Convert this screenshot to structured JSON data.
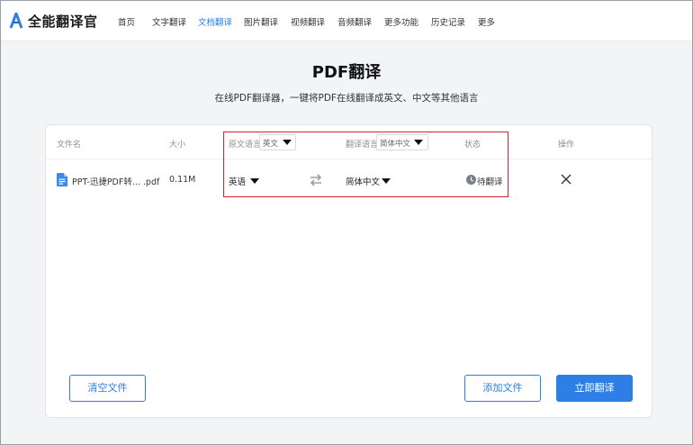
{
  "app": {
    "logo_text": "全能翻译官",
    "brand_color": "#2d7fe6",
    "highlight_color": "#d9232c"
  },
  "nav": {
    "items": [
      {
        "label": "首页",
        "active": false
      },
      {
        "label": "文字翻译",
        "active": false
      },
      {
        "label": "文档翻译",
        "active": true
      },
      {
        "label": "图片翻译",
        "active": false
      },
      {
        "label": "视频翻译",
        "active": false
      },
      {
        "label": "音频翻译",
        "active": false
      },
      {
        "label": "更多功能",
        "active": false
      },
      {
        "label": "历史记录",
        "active": false
      },
      {
        "label": "更多",
        "active": false
      }
    ]
  },
  "page": {
    "title": "PDF翻译",
    "subtitle": "在线PDF翻译器，一键将PDF在线翻译成英文、中文等其他语言"
  },
  "table": {
    "headers": {
      "file_name": "文件名",
      "size": "大小",
      "source_lang": "原文语言",
      "target_lang": "翻译语言",
      "status": "状态",
      "action": "操作"
    },
    "header_source_select": "英文",
    "header_target_select": "简体中文",
    "rows": [
      {
        "file_name": "PPT-迅捷PDF转...  .pdf",
        "size": "0.11M",
        "source_lang": "英语",
        "target_lang": "简体中文",
        "status": "待翻译",
        "icons": [
          "file-pdf-icon",
          "swap-icon",
          "clock-icon",
          "close-icon"
        ]
      }
    ]
  },
  "buttons": {
    "clear": "清空文件",
    "add": "添加文件",
    "translate": "立即翻译"
  }
}
